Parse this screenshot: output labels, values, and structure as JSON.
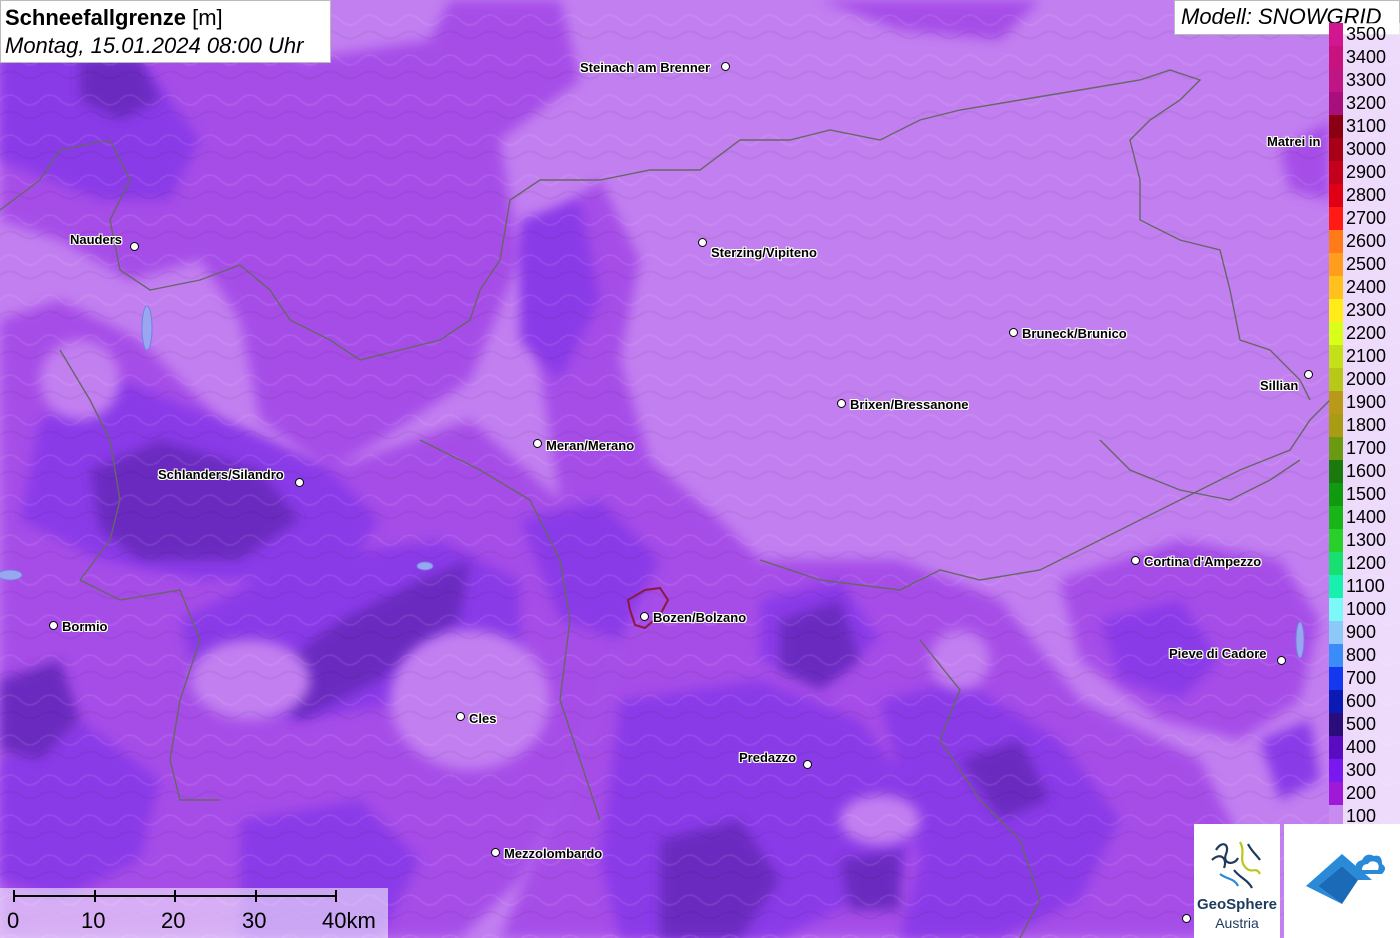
{
  "title": {
    "parameter": "Schneefallgrenze",
    "unit": "[m]",
    "datetime": "Montag, 15.01.2024 08:00 Uhr"
  },
  "model": "Modell: SNOWGRID",
  "cities": [
    {
      "name": "Steinach am Brenner"
    },
    {
      "name": "Nauders"
    },
    {
      "name": "Sterzing/Vipiteno"
    },
    {
      "name": "Matrei in"
    },
    {
      "name": "Bruneck/Brunico"
    },
    {
      "name": "Sillian"
    },
    {
      "name": "Brixen/Bressanone"
    },
    {
      "name": "Meran/Merano"
    },
    {
      "name": "Schlanders/Silandro"
    },
    {
      "name": "Cortina d'Ampezzo"
    },
    {
      "name": "Bozen/Bolzano"
    },
    {
      "name": "Bormio"
    },
    {
      "name": "Pieve di Cadore"
    },
    {
      "name": "Cles"
    },
    {
      "name": "Predazzo"
    },
    {
      "name": "Mezzolombardo"
    }
  ],
  "legend": [
    {
      "label": "3500",
      "color": "#d21590"
    },
    {
      "label": "3400",
      "color": "#c8137f"
    },
    {
      "label": "3300",
      "color": "#c01585"
    },
    {
      "label": "3200",
      "color": "#a80f7c"
    },
    {
      "label": "3100",
      "color": "#8a0012"
    },
    {
      "label": "3000",
      "color": "#a80014"
    },
    {
      "label": "2900",
      "color": "#c4001a"
    },
    {
      "label": "2800",
      "color": "#e00016"
    },
    {
      "label": "2700",
      "color": "#ff1a14"
    },
    {
      "label": "2600",
      "color": "#ff7a18"
    },
    {
      "label": "2500",
      "color": "#ff9e1c"
    },
    {
      "label": "2400",
      "color": "#ffc21c"
    },
    {
      "label": "2300",
      "color": "#ffec18"
    },
    {
      "label": "2200",
      "color": "#d8ff1a"
    },
    {
      "label": "2100",
      "color": "#c4e01a"
    },
    {
      "label": "2000",
      "color": "#b8c818"
    },
    {
      "label": "1900",
      "color": "#b89a18"
    },
    {
      "label": "1800",
      "color": "#a89c14"
    },
    {
      "label": "1700",
      "color": "#6a9a12"
    },
    {
      "label": "1600",
      "color": "#1a7a0e"
    },
    {
      "label": "1500",
      "color": "#0f9a10"
    },
    {
      "label": "1400",
      "color": "#18b418"
    },
    {
      "label": "1300",
      "color": "#2ad02a"
    },
    {
      "label": "1200",
      "color": "#18e070"
    },
    {
      "label": "1100",
      "color": "#18f0b0"
    },
    {
      "label": "1000",
      "color": "#7cf8f8"
    },
    {
      "label": "900",
      "color": "#8cc8f8"
    },
    {
      "label": "800",
      "color": "#3a8cf8"
    },
    {
      "label": "700",
      "color": "#1438f0"
    },
    {
      "label": "600",
      "color": "#0c1ab4"
    },
    {
      "label": "500",
      "color": "#2a0c7a"
    },
    {
      "label": "400",
      "color": "#5a0cc0"
    },
    {
      "label": "300",
      "color": "#7a18f0"
    },
    {
      "label": "200",
      "color": "#a018d8"
    },
    {
      "label": "100",
      "color": "#c88cf0"
    }
  ],
  "scale_bar": {
    "labels": [
      "0",
      "10",
      "20",
      "30",
      "40km"
    ]
  },
  "logo": {
    "name_line1": "GeoSphere",
    "name_line2": "Austria"
  },
  "colors": {
    "background_light": "#c27ff0",
    "mid_purple": "#a64de8",
    "violet": "#8a3ae8",
    "dark_violet": "#6a2bc0",
    "darkest": "#52288f",
    "border": "#555555"
  }
}
